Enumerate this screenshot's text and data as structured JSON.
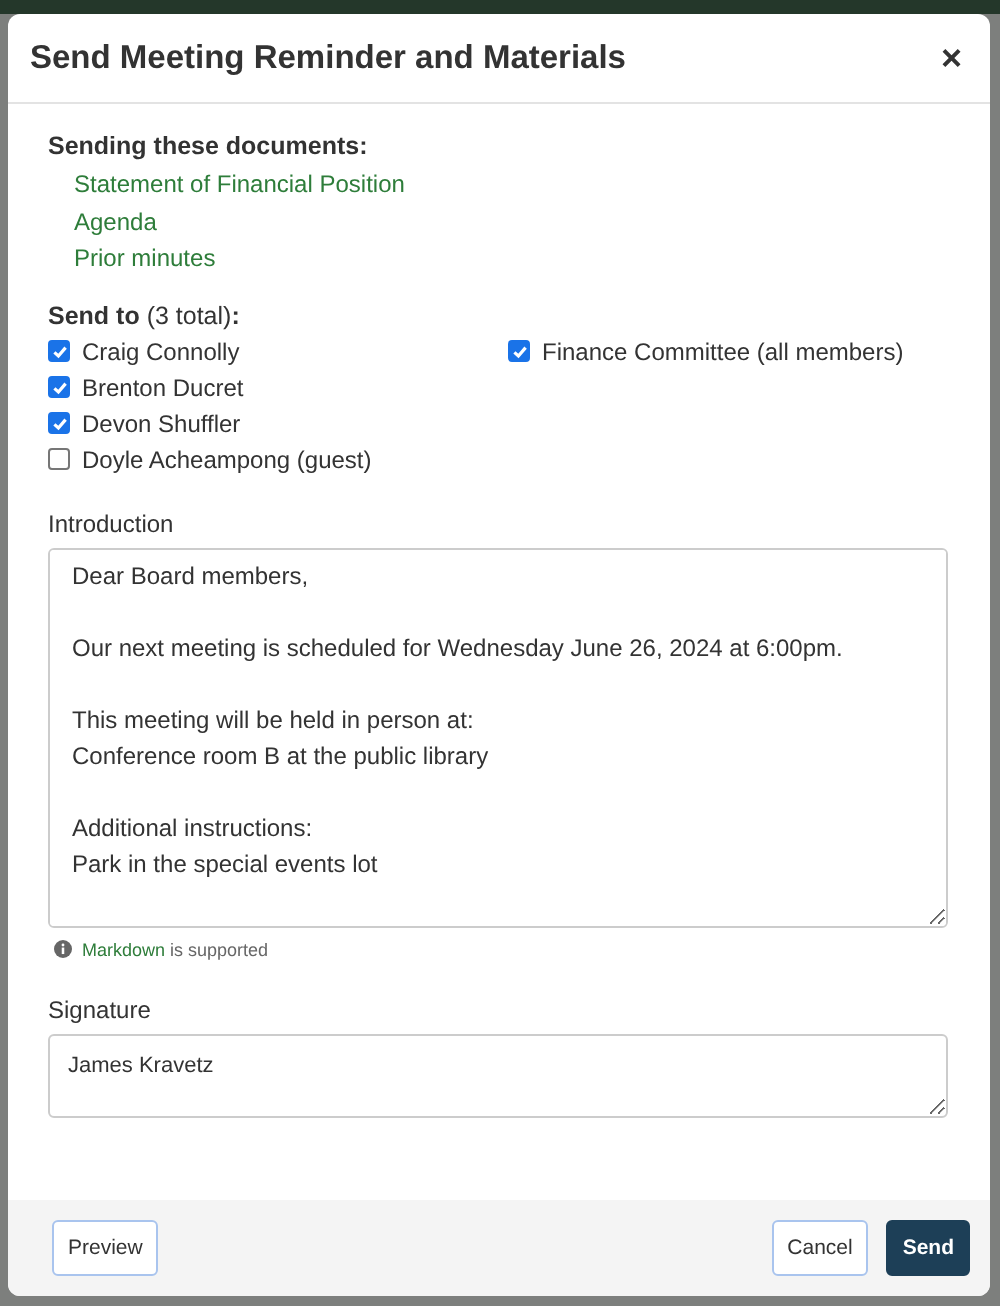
{
  "dialog": {
    "title": "Send Meeting Reminder and Materials",
    "close": "×"
  },
  "documents": {
    "heading": "Sending these documents:",
    "items": [
      "Statement of Financial Position",
      "Agenda",
      "Prior minutes"
    ]
  },
  "recipients": {
    "heading": "**Send to** (3 total)**:**",
    "columns": [
      [
        {
          "label": "Craig Connolly",
          "checked": true
        },
        {
          "label": "Brenton Ducret",
          "checked": true
        },
        {
          "label": "Devon Shuffler",
          "checked": true
        },
        {
          "label": "Doyle Acheampong (guest)",
          "checked": false
        }
      ],
      [
        {
          "label": "Finance Committee (all members)",
          "checked": true
        }
      ]
    ]
  },
  "introduction": {
    "label": "Introduction",
    "value": "Dear Board members,\n\nOur next meeting is scheduled for Wednesday June 26, 2024 at 6:00pm.\n\nThis meeting will be held in person at:\nConference room B at the public library\n\nAdditional instructions:\nPark in the special events lot\n\n"
  },
  "hint": {
    "link": "Markdown",
    "text": "is supported"
  },
  "signature": {
    "label": "Signature",
    "value": "James Kravetz"
  },
  "footer": {
    "preview": "Preview",
    "cancel": "Cancel",
    "send": "Send"
  }
}
